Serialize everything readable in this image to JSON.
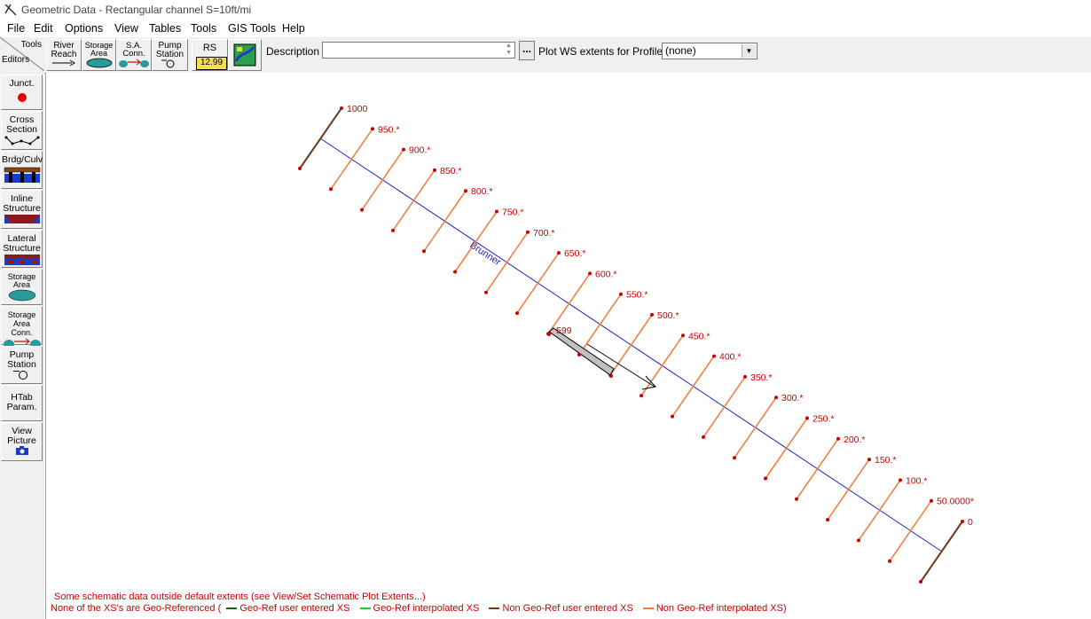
{
  "window": {
    "title": "Geometric Data - Rectangular channel S=10ft/mi"
  },
  "menu": [
    "File",
    "Edit",
    "Options",
    "View",
    "Tables",
    "Tools",
    "GIS Tools",
    "Help"
  ],
  "toolbar": {
    "tools_label": "Tools",
    "editors_label": "Editors",
    "buttons": [
      "River Reach",
      "Storage Area",
      "S.A. Conn.",
      "Pump Station",
      "RS",
      "12.99"
    ],
    "description_label": "Description :",
    "description_value": "",
    "ellipsis": "...",
    "plot_ws_label": "Plot WS extents for Profile:",
    "profile_value": "(none)"
  },
  "sidebar": [
    "Junct.",
    "Cross Section",
    "Brdg/Culv",
    "Inline Structure",
    "Lateral Structure",
    "Storage Area",
    "Storage Area Conn.",
    "Pump Station",
    "HTab Param.",
    "View Picture"
  ],
  "schematic": {
    "river_label": "Brunner",
    "storage_label": "599",
    "cross_sections": [
      "1000",
      "950.*",
      "900.*",
      "850.*",
      "800.*",
      "750.*",
      "700.*",
      "650.*",
      "600.*",
      "550.*",
      "500.*",
      "450.*",
      "400.*",
      "350.*",
      "300.*",
      "250.*",
      "200.*",
      "150.*",
      "100.*",
      "50.0000*",
      "0"
    ]
  },
  "messages": {
    "extents": "Some schematic data outside default extents (see View/Set Schematic Plot Extents...)",
    "georef": "None of the XS's are Geo-Referenced (",
    "legend": [
      "Geo-Ref user entered XS",
      "Geo-Ref interpolated XS",
      "Non Geo-Ref user entered XS",
      "Non Geo-Ref interpolated XS)"
    ]
  },
  "colors": {
    "red": "#cc0000",
    "river": "#2020c0",
    "interp_xs": "#f08040",
    "user_xs": "#6b3a1a",
    "georef_user": "#1a5e1a",
    "georef_interp": "#30c030"
  }
}
